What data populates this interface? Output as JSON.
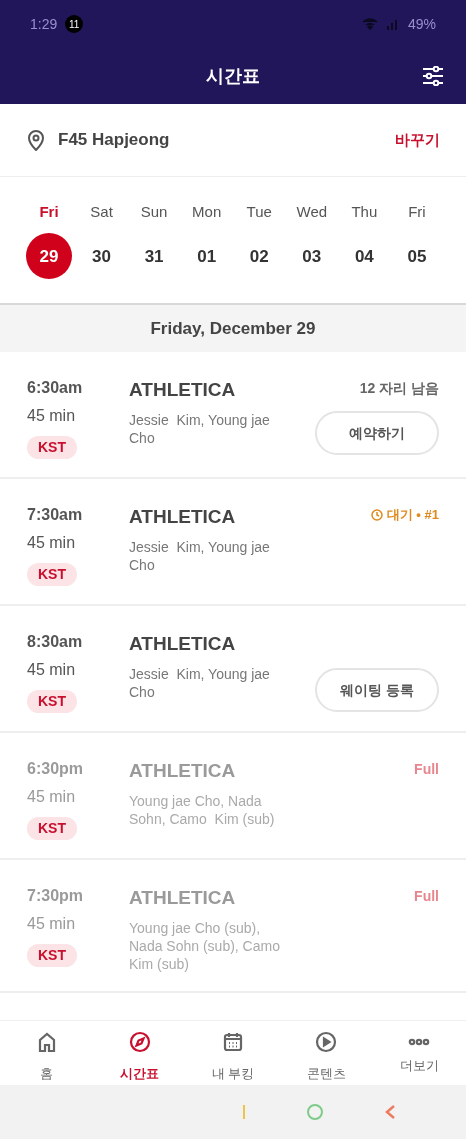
{
  "status_bar": {
    "time": "1:29",
    "notification_count": "11",
    "battery": "49%"
  },
  "header": {
    "title": "시간표"
  },
  "location": {
    "name": "F45 Hapjeong",
    "change_link": "바꾸기"
  },
  "days": [
    {
      "weekday": "Fri",
      "date": "29",
      "selected": true
    },
    {
      "weekday": "Sat",
      "date": "30",
      "selected": false
    },
    {
      "weekday": "Sun",
      "date": "31",
      "selected": false
    },
    {
      "weekday": "Mon",
      "date": "01",
      "selected": false
    },
    {
      "weekday": "Tue",
      "date": "02",
      "selected": false
    },
    {
      "weekday": "Wed",
      "date": "03",
      "selected": false
    },
    {
      "weekday": "Thu",
      "date": "04",
      "selected": false
    },
    {
      "weekday": "Fri",
      "date": "05",
      "selected": false
    }
  ],
  "date_heading": "Friday, December 29",
  "classes": [
    {
      "time": "6:30am",
      "duration": "45 min",
      "timezone": "KST",
      "name": "ATHLETICA",
      "coaches": "Jessie  Kim, Young jae Cho",
      "disabled": false,
      "status": {
        "kind": "seats",
        "text": "12 자리 남음"
      },
      "button": "예약하기"
    },
    {
      "time": "7:30am",
      "duration": "45 min",
      "timezone": "KST",
      "name": "ATHLETICA",
      "coaches": "Jessie  Kim, Young jae Cho",
      "disabled": false,
      "status": {
        "kind": "waitlist",
        "text": "대기 • #1"
      }
    },
    {
      "time": "8:30am",
      "duration": "45 min",
      "timezone": "KST",
      "name": "ATHLETICA",
      "coaches": "Jessie  Kim, Young jae Cho",
      "disabled": false,
      "button": "웨이팅 등록"
    },
    {
      "time": "6:30pm",
      "duration": "45 min",
      "timezone": "KST",
      "name": "ATHLETICA",
      "coaches": "Young jae Cho, Nada Sohn, Camo  Kim (sub)",
      "disabled": true,
      "status": {
        "kind": "full",
        "text": "Full"
      }
    },
    {
      "time": "7:30pm",
      "duration": "45 min",
      "timezone": "KST",
      "name": "ATHLETICA",
      "coaches": "Young jae Cho (sub), Nada Sohn (sub), Camo Kim (sub)",
      "disabled": true,
      "status": {
        "kind": "full",
        "text": "Full"
      }
    }
  ],
  "bottom_nav": [
    {
      "kind": "home",
      "label": "홈",
      "selected": false
    },
    {
      "kind": "compass",
      "label": "시간표",
      "selected": true
    },
    {
      "kind": "calendar",
      "label": "내 부킹",
      "selected": false
    },
    {
      "kind": "play",
      "label": "콘텐츠",
      "selected": false
    },
    {
      "kind": "more",
      "label": "더보기",
      "selected": false
    }
  ]
}
